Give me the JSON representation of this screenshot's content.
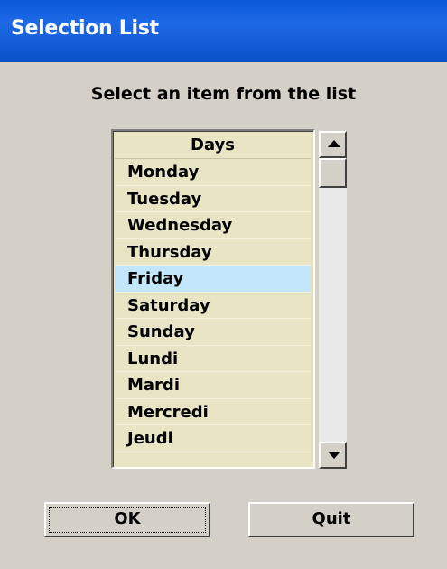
{
  "window": {
    "title": "Selection List"
  },
  "prompt": "Select an item from the list",
  "list": {
    "header": "Days",
    "items": [
      "Monday",
      "Tuesday",
      "Wednesday",
      "Thursday",
      "Friday",
      "Saturday",
      "Sunday",
      "Lundi",
      "Mardi",
      "Mercredi",
      "Jeudi"
    ],
    "selected": "Friday"
  },
  "buttons": {
    "ok": "OK",
    "quit": "Quit"
  },
  "colors": {
    "titlebar": "#0b58d6",
    "list_bg": "#e8e4c4",
    "selected_bg": "#c2e6fa",
    "dialog_bg": "#d4d0c8"
  },
  "icons": {
    "scroll_up": "arrow-up-icon",
    "scroll_down": "arrow-down-icon"
  }
}
